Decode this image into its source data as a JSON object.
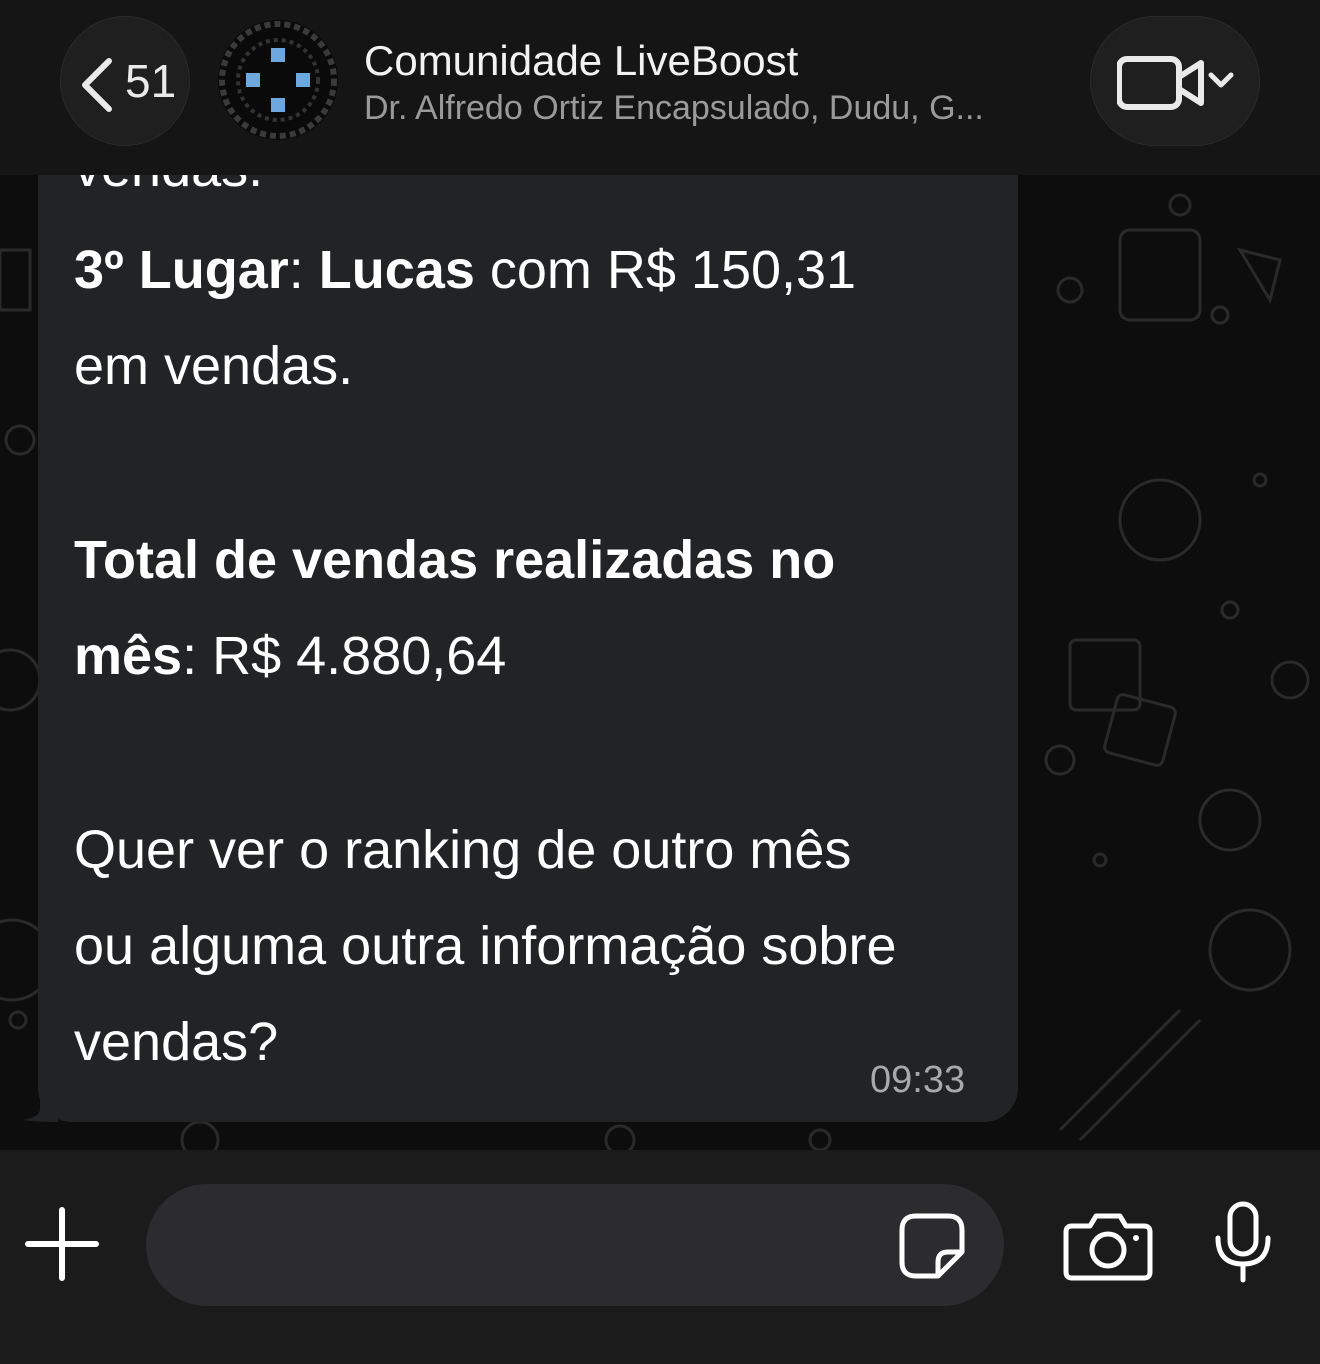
{
  "header": {
    "back_count": "51",
    "title": "Comunidade LiveBoost",
    "subtitle": "Dr. Alfredo Ortiz Encapsulado, Dudu, G..."
  },
  "message": {
    "partial_top": "vendas.",
    "third_place": {
      "label": "3º Lugar",
      "sep": ": ",
      "name": "Lucas",
      "rest": " com R$ 150,31",
      "line2": "em vendas."
    },
    "total": {
      "label_line1": "Total de vendas realizadas no",
      "label_line2": "mês",
      "sep": ": ",
      "value": "R$ 4.880,64"
    },
    "question": {
      "line1": "Quer ver o ranking de outro mês",
      "line2": "ou alguma outra informação sobre",
      "line3": "vendas?"
    },
    "time": "09:33"
  },
  "composer": {
    "input_value": ""
  },
  "icons": {
    "back": "chevron-left-icon",
    "video": "video-camera-icon",
    "plus": "plus-icon",
    "sticker": "sticker-icon",
    "camera": "camera-icon",
    "mic": "microphone-icon"
  },
  "colors": {
    "header_bg": "#151515",
    "bubble_bg": "#212325",
    "wallpaper_bg": "#0d0d0d",
    "composer_bg": "#1b1b1b",
    "avatar_accent": "#6fa8dc"
  }
}
